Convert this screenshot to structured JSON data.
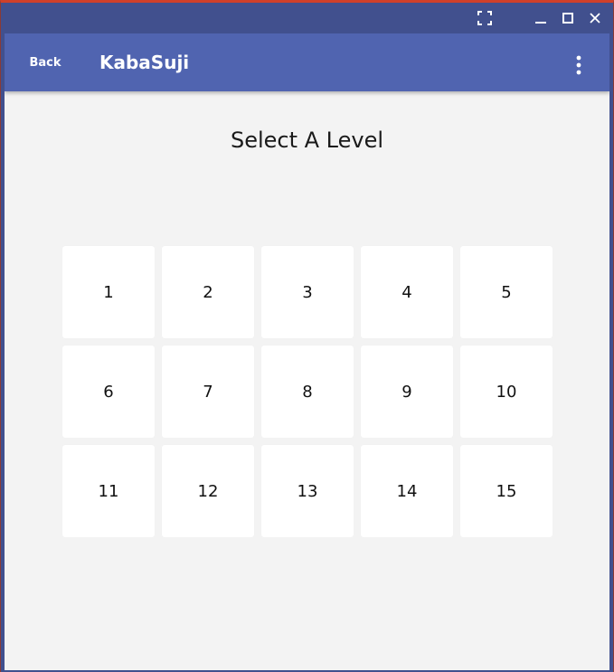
{
  "window": {
    "title_buttons": {
      "fullscreen_icon": "fullscreen-icon",
      "minimize_icon": "minimize-icon",
      "maximize_icon": "maximize-icon",
      "close_icon": "close-icon"
    }
  },
  "appbar": {
    "back_label": "Back",
    "title": "KabaSuji",
    "menu_icon": "more-vertical-icon"
  },
  "main": {
    "heading": "Select A Level",
    "levels": [
      "1",
      "2",
      "3",
      "4",
      "5",
      "6",
      "7",
      "8",
      "9",
      "10",
      "11",
      "12",
      "13",
      "14",
      "15"
    ]
  },
  "colors": {
    "window_frame": "#41508e",
    "appbar": "#5064b0",
    "background": "#f3f3f3",
    "tile": "#ffffff",
    "accent_border": "#d0402a"
  }
}
